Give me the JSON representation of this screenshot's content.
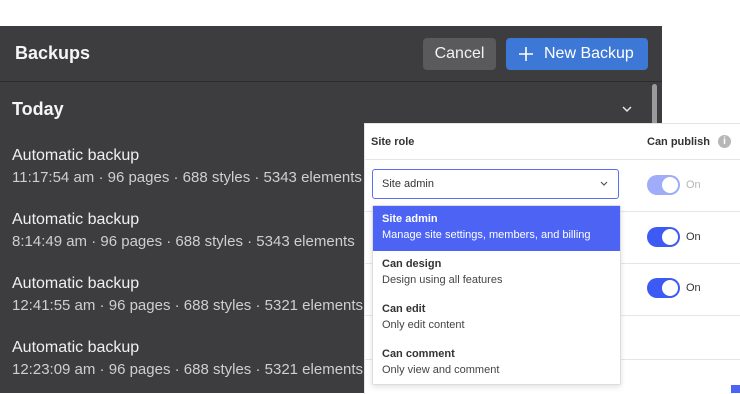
{
  "backups": {
    "title": "Backups",
    "cancel_label": "Cancel",
    "new_backup_label": "New Backup",
    "section_label": "Today",
    "items": [
      {
        "name": "Automatic backup",
        "meta": "11:17:54 am · 96 pages · 688 styles · 5343 elements"
      },
      {
        "name": "Automatic backup",
        "meta": "8:14:49 am · 96 pages · 688 styles · 5343 elements"
      },
      {
        "name": "Automatic backup",
        "meta": "12:41:55 am · 96 pages · 688 styles · 5321 elements"
      },
      {
        "name": "Automatic backup",
        "meta": "12:23:09 am · 96 pages · 688 styles · 5321 elements"
      }
    ]
  },
  "roles": {
    "header_role": "Site role",
    "header_publish": "Can publish",
    "info_glyph": "i",
    "select_value": "Site admin",
    "options": [
      {
        "title": "Site admin",
        "desc": "Manage site settings, members, and billing"
      },
      {
        "title": "Can design",
        "desc": "Design using all features"
      },
      {
        "title": "Can edit",
        "desc": "Only edit content"
      },
      {
        "title": "Can comment",
        "desc": "Only view and comment"
      }
    ],
    "toggles": [
      {
        "label": "On",
        "state": "on-disabled"
      },
      {
        "label": "On",
        "state": "on"
      },
      {
        "label": "On",
        "state": "on"
      }
    ]
  },
  "colors": {
    "dark_panel": "#3d3c3e",
    "primary_button": "#3d78d6",
    "accent": "#4d63f4",
    "toggle_on": "#3d5af5"
  },
  "icons": [
    "plus-icon",
    "chevron-down-icon",
    "info-icon"
  ]
}
